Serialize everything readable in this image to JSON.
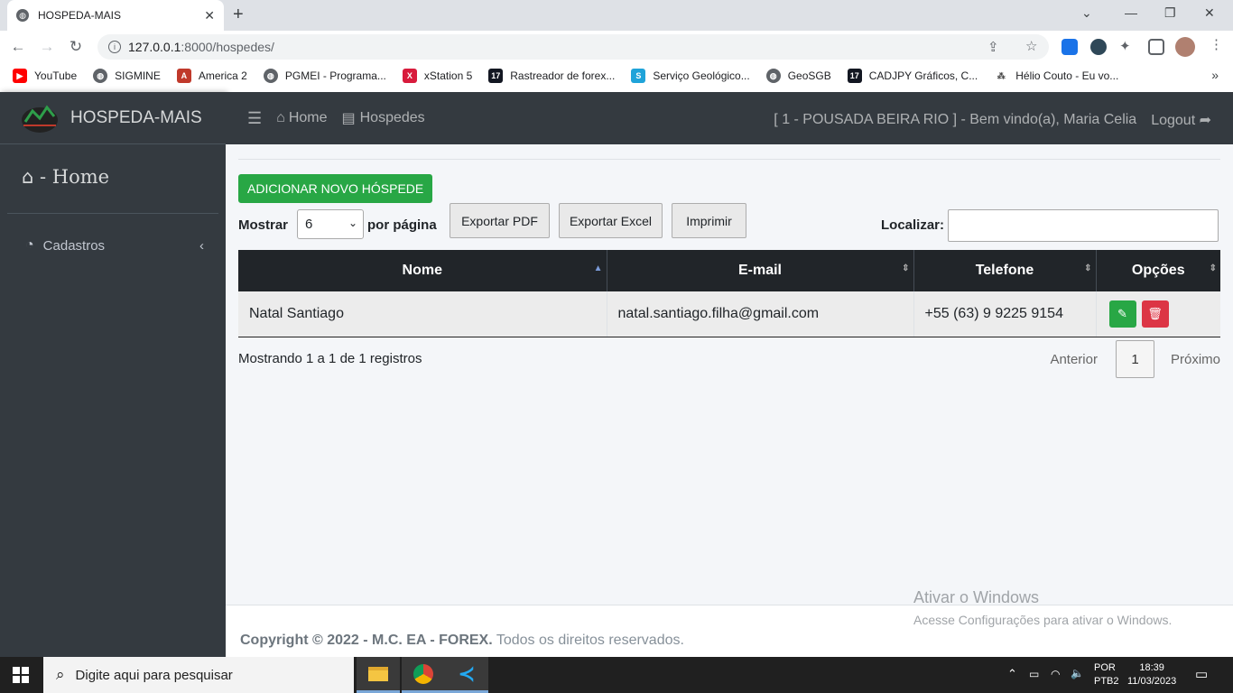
{
  "browser": {
    "tab_title": "HOSPEDA-MAIS",
    "url_host": "127.0.0.1",
    "url_path": ":8000/hospedes/",
    "bookmarks": [
      {
        "label": "YouTube",
        "color": "#ff0000"
      },
      {
        "label": "SIGMINE",
        "color": "#5f6368"
      },
      {
        "label": "America 2",
        "color": "#c0392b"
      },
      {
        "label": "PGMEI - Programa...",
        "color": "#5f6368"
      },
      {
        "label": "xStation 5",
        "color": "#d81b3c"
      },
      {
        "label": "Rastreador de forex...",
        "color": "#131722"
      },
      {
        "label": "Serviço Geológico...",
        "color": "#1fa3d9"
      },
      {
        "label": "GeoSGB",
        "color": "#5f6368"
      },
      {
        "label": "CADJPY Gráficos, C...",
        "color": "#131722"
      },
      {
        "label": "Hélio Couto - Eu vo...",
        "color": "#444"
      }
    ]
  },
  "app": {
    "brand": "HOSPEDA-MAIS",
    "sidebar": {
      "home": " - Home",
      "cadastros": "Cadastros"
    },
    "topnav": {
      "home": "Home",
      "hospedes": "Hospedes",
      "welcome": "[ 1 - POUSADA BEIRA RIO ] - Bem vindo(a), Maria Celia",
      "logout": "Logout"
    },
    "add_button": "ADICIONAR NOVO HÓSPEDE",
    "show_label": "Mostrar",
    "page_size": "6",
    "per_page_label": "por página",
    "export_pdf": "Exportar PDF",
    "export_excel": "Exportar Excel",
    "print": "Imprimir",
    "search_label": "Localizar:",
    "table": {
      "headers": [
        "Nome",
        "E-mail",
        "Telefone",
        "Opções"
      ],
      "rows": [
        {
          "nome": "Natal Santiago",
          "email": "natal.santiago.filha@gmail.com",
          "telefone": "+55 (63) 9 9225 9154"
        }
      ]
    },
    "info": "Mostrando 1 a 1 de 1 registros",
    "pager": {
      "prev": "Anterior",
      "current": "1",
      "next": "Próximo"
    },
    "footer": {
      "copyright": "Copyright © 2022 - M.C. EA - FOREX.",
      "rights": " Todos os direitos reservados."
    },
    "colors": {
      "success": "#28a745",
      "danger": "#dc3545",
      "sidebar": "#343a40"
    }
  },
  "watermark": {
    "line1": "Ativar o Windows",
    "line2": "Acesse Configurações para ativar o Windows."
  },
  "taskbar": {
    "search_placeholder": "Digite aqui para pesquisar",
    "lang1": "POR",
    "lang2": "PTB2",
    "time": "18:39",
    "date": "11/03/2023"
  }
}
